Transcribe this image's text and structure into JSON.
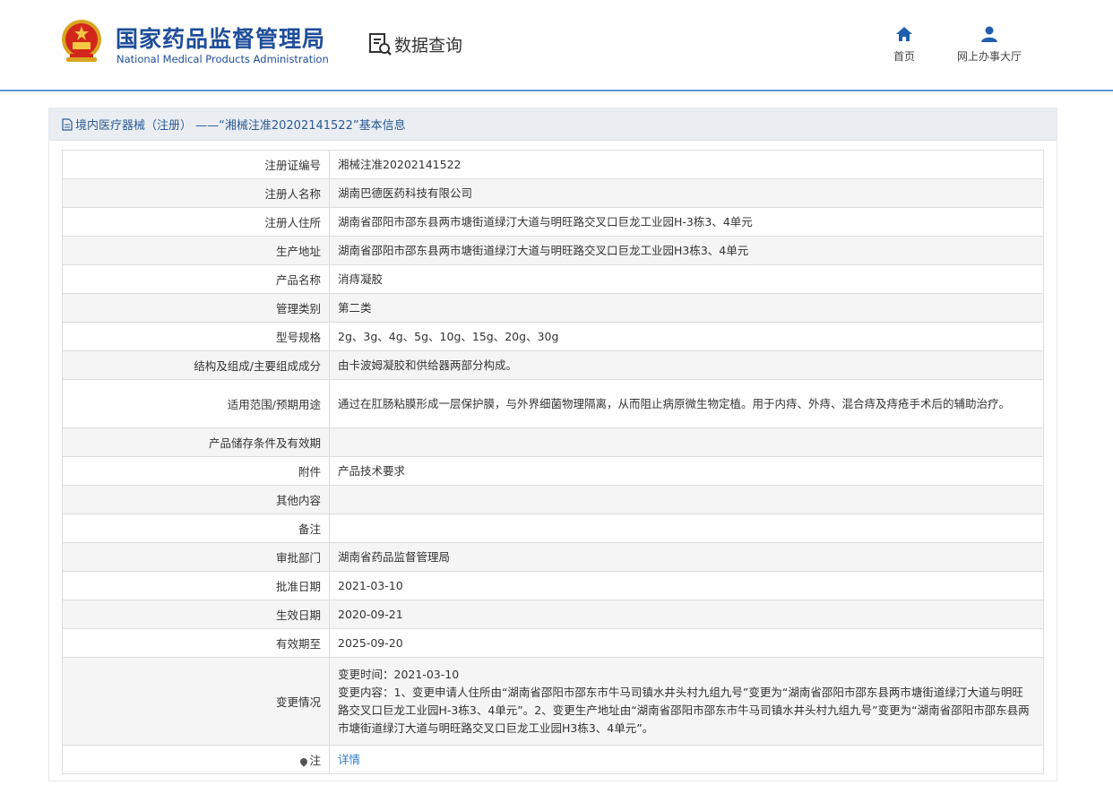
{
  "header": {
    "org_name_cn": "国家药品监督管理局",
    "org_name_en": "National Medical Products Administration",
    "section_title": "数据查询",
    "nav": {
      "home_label": "首页",
      "online_hall_label": "网上办事大厅"
    }
  },
  "panel": {
    "title": "境内医疗器械（注册） ——“湘械注准20202141522”基本信息"
  },
  "rows": [
    {
      "key": "注册证编号",
      "value": "湘械注准20202141522"
    },
    {
      "key": "注册人名称",
      "value": "湖南巴德医药科技有限公司"
    },
    {
      "key": "注册人住所",
      "value": "湖南省邵阳市邵东县两市塘街道绿汀大道与明旺路交叉口巨龙工业园H-3栋3、4单元"
    },
    {
      "key": "生产地址",
      "value": "湖南省邵阳市邵东县两市塘街道绿汀大道与明旺路交叉口巨龙工业园H3栋3、4单元"
    },
    {
      "key": "产品名称",
      "value": "消痔凝胶"
    },
    {
      "key": "管理类别",
      "value": "第二类"
    },
    {
      "key": "型号规格",
      "value": "2g、3g、4g、5g、10g、15g、20g、30g"
    },
    {
      "key": "结构及组成/主要组成成分",
      "value": "由卡波姆凝胶和供给器两部分构成。"
    },
    {
      "key": "适用范围/预期用途",
      "value": "通过在肛肠粘膜形成一层保护膜，与外界细菌物理隔离，从而阻止病原微生物定植。用于内痔、外痔、混合痔及痔疮手术后的辅助治疗。"
    },
    {
      "key": "产品储存条件及有效期",
      "value": ""
    },
    {
      "key": "附件",
      "value": "产品技术要求"
    },
    {
      "key": "其他内容",
      "value": ""
    },
    {
      "key": "备注",
      "value": ""
    },
    {
      "key": "审批部门",
      "value": "湖南省药品监督管理局"
    },
    {
      "key": "批准日期",
      "value": "2021-03-10"
    },
    {
      "key": "生效日期",
      "value": "2020-09-21"
    },
    {
      "key": "有效期至",
      "value": "2025-09-20"
    },
    {
      "key": "变更情况",
      "value_line1": "变更时间：2021-03-10",
      "value_line2": "变更内容：1、变更申请人住所由“湖南省邵阳市邵东市牛马司镇水井头村九组九号”变更为“湖南省邵阳市邵东县两市塘街道绿汀大道与明旺路交叉口巨龙工业园H-3栋3、4单元”。2、变更生产地址由“湖南省邵阳市邵东市牛马司镇水井头村九组九号”变更为“湖南省邵阳市邵东县两市塘街道绿汀大道与明旺路交叉口巨龙工业园H3栋3、4单元”。"
    },
    {
      "key": "注",
      "value": "详情"
    }
  ],
  "colors": {
    "brand_blue": "#1f4e9a",
    "link_blue": "#2f7ecb",
    "header_line": "#5b9bd5"
  }
}
